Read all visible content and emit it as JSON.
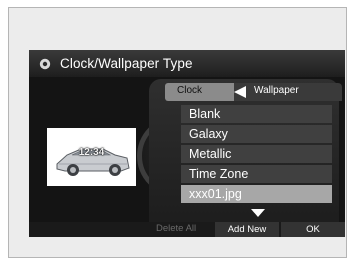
{
  "title": "Clock/Wallpaper Type",
  "title_icon": "gear-icon",
  "tabs": [
    {
      "label": "Clock",
      "selected": false
    },
    {
      "label": "Wallpaper",
      "selected": true
    }
  ],
  "preview": {
    "time": "12:34",
    "image": "car"
  },
  "list": [
    {
      "label": "Blank",
      "selected": false
    },
    {
      "label": "Galaxy",
      "selected": false
    },
    {
      "label": "Metallic",
      "selected": false
    },
    {
      "label": "Time Zone",
      "selected": false
    },
    {
      "label": "xxx01.jpg",
      "selected": true
    }
  ],
  "footer": {
    "delete_all": "Delete All",
    "add_new": "Add New",
    "ok": "OK"
  },
  "colors": {
    "screen_bg": "#141414",
    "item_bg": "#404040",
    "selected_bg": "#a7a7a7",
    "tab_bg": "#8b8b8b"
  }
}
